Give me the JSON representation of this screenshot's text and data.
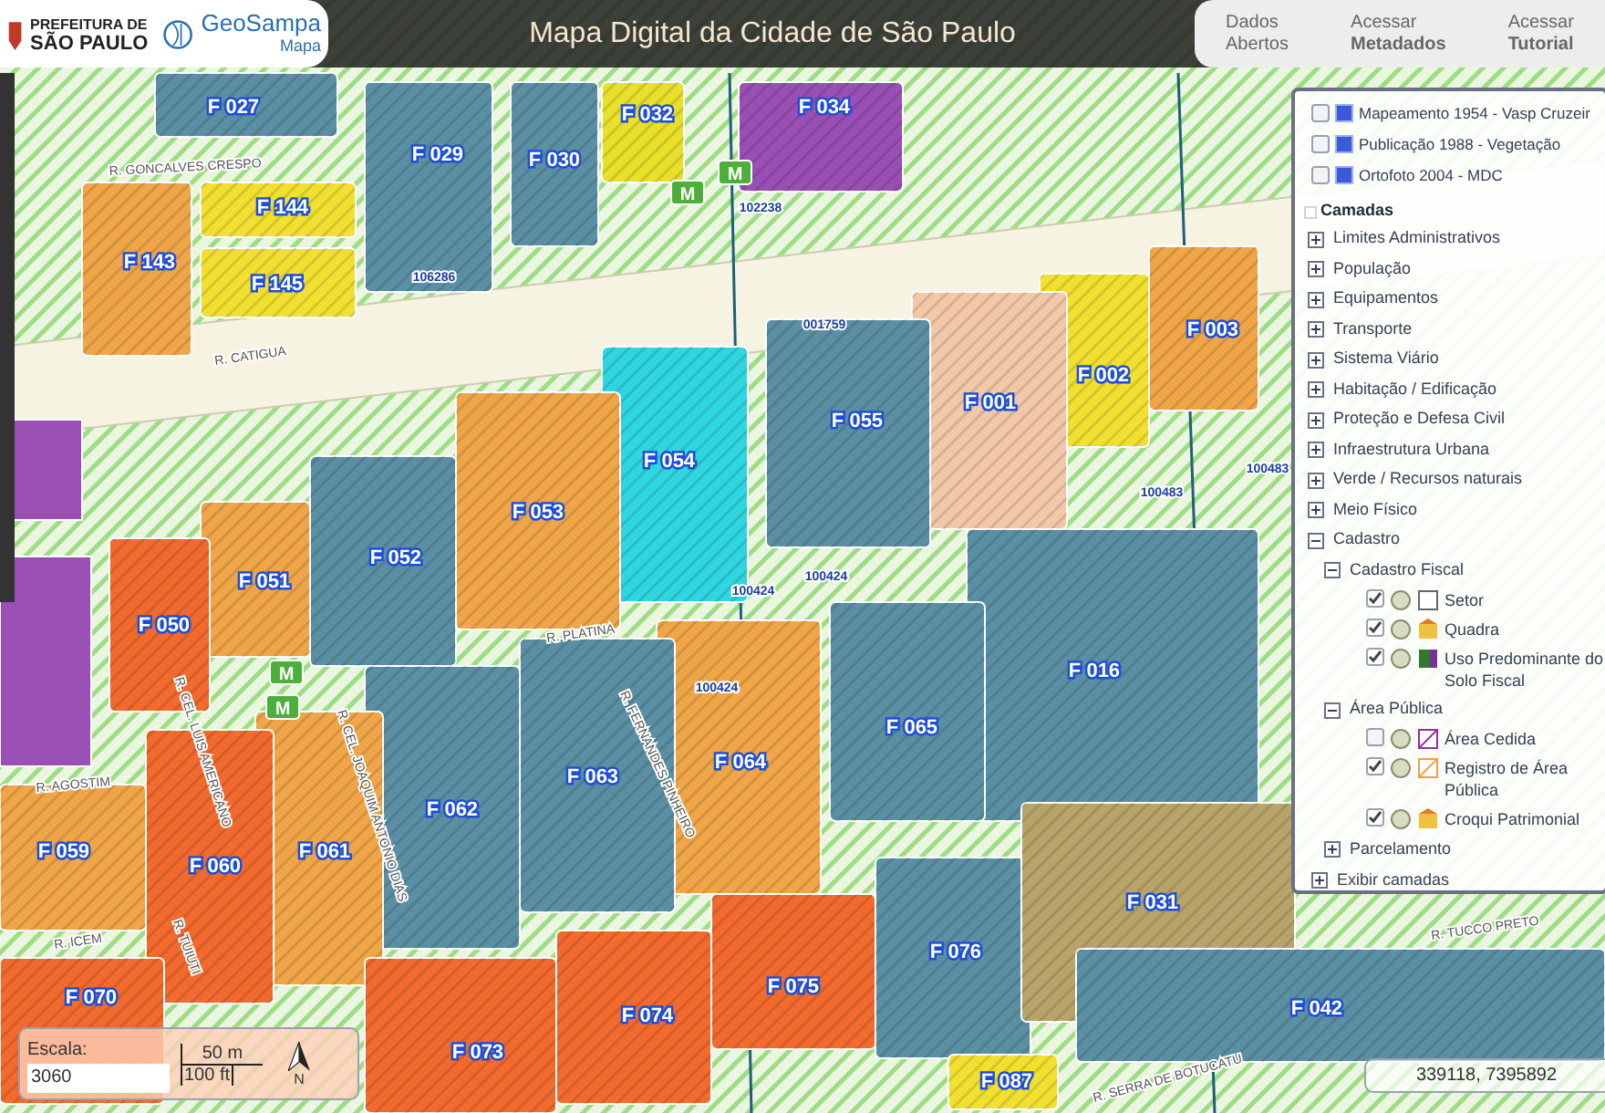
{
  "header": {
    "logo_top": "PREFEITURA DE",
    "logo_bottom": "SÃO PAULO",
    "brand": "GeoSampa",
    "brand_sub": "Mapa",
    "title": "Mapa Digital da Cidade de São Paulo",
    "links": [
      {
        "line1": "Dados",
        "line2": "Abertos",
        "bold": false
      },
      {
        "line1": "Acessar",
        "line2": "Metadados",
        "bold": true
      },
      {
        "line1": "Acessar",
        "line2": "Tutorial",
        "bold": true
      }
    ]
  },
  "map": {
    "lots": [
      {
        "label": "F 027",
        "color": "#5b8fa3"
      },
      {
        "label": "F 029",
        "color": "#5b8fa3"
      },
      {
        "label": "F 030",
        "color": "#5b8fa3"
      },
      {
        "label": "F 032",
        "color": "#e8e02a"
      },
      {
        "label": "F 034",
        "color": "#9a4fb5"
      },
      {
        "label": "F 144",
        "color": "#f1e030"
      },
      {
        "label": "F 145",
        "color": "#f1e030"
      },
      {
        "label": "F 143",
        "color": "#f0a648"
      },
      {
        "label": "F 003",
        "color": "#f0a648"
      },
      {
        "label": "F 002",
        "color": "#f1e030"
      },
      {
        "label": "F 001",
        "color": "#f2c8a8"
      },
      {
        "label": "F 055",
        "color": "#5b8fa3"
      },
      {
        "label": "F 054",
        "color": "#2fd6e0"
      },
      {
        "label": "F 053",
        "color": "#f0a648"
      },
      {
        "label": "F 052",
        "color": "#5b8fa3"
      },
      {
        "label": "F 051",
        "color": "#f0a648"
      },
      {
        "label": "F 050",
        "color": "#f26a2e"
      },
      {
        "label": "F 016",
        "color": "#5b8fa3"
      },
      {
        "label": "F 065",
        "color": "#5b8fa3"
      },
      {
        "label": "F 064",
        "color": "#f0a648"
      },
      {
        "label": "F 063",
        "color": "#5b8fa3"
      },
      {
        "label": "F 062",
        "color": "#5b8fa3"
      },
      {
        "label": "F 061",
        "color": "#f0a648"
      },
      {
        "label": "F 060",
        "color": "#f26a2e"
      },
      {
        "label": "F 059",
        "color": "#f0a648"
      },
      {
        "label": "F 070",
        "color": "#f26a2e"
      },
      {
        "label": "F 073",
        "color": "#f26a2e"
      },
      {
        "label": "F 074",
        "color": "#f26a2e"
      },
      {
        "label": "F 075",
        "color": "#f26a2e"
      },
      {
        "label": "F 076",
        "color": "#5b8fa3"
      },
      {
        "label": "F 031",
        "color": "#b8a46a"
      },
      {
        "label": "F 042",
        "color": "#5b8fa3"
      },
      {
        "label": "F 087",
        "color": "#f1e030"
      }
    ],
    "streets": [
      "R. GONCALVES CRESPO",
      "R. CATIGUA",
      "R. PLATINA",
      "R. CEL. LUIS AMERICANO",
      "R. CEL. JOAQUIM ANTONIO DIAS",
      "R. FERNANDES PINHEIRO",
      "R. TUIUTI",
      "R. ICEM",
      "R. SERRA DE BOTUCATU",
      "R. TUCCO PRETO",
      "R. AGOSTIM"
    ],
    "codes": [
      "102238",
      "106286",
      "001759",
      "100424",
      "100424",
      "100424",
      "100483",
      "100483"
    ],
    "stations": [
      "M",
      "M",
      "M",
      "M"
    ]
  },
  "layers": {
    "basemaps": [
      {
        "label": "Mapeamento 1954 - Vasp Cruzeir",
        "checked": false
      },
      {
        "label": "Publicação 1988 - Vegetação",
        "checked": false
      },
      {
        "label": "Ortofoto 2004 - MDC",
        "checked": false
      }
    ],
    "title": "Camadas",
    "tree": [
      {
        "label": "Limites Administrativos",
        "expanded": false
      },
      {
        "label": "População",
        "expanded": false
      },
      {
        "label": "Equipamentos",
        "expanded": false
      },
      {
        "label": "Transporte",
        "expanded": false
      },
      {
        "label": "Sistema Viário",
        "expanded": false
      },
      {
        "label": "Habitação / Edificação",
        "expanded": false
      },
      {
        "label": "Proteção e Defesa Civil",
        "expanded": false
      },
      {
        "label": "Infraestrutura Urbana",
        "expanded": false
      },
      {
        "label": "Verde / Recursos naturais",
        "expanded": false
      },
      {
        "label": "Meio Físico",
        "expanded": false
      },
      {
        "label": "Cadastro",
        "expanded": true,
        "children": [
          {
            "label": "Cadastro Fiscal",
            "expanded": true,
            "children": [
              {
                "kind": "outline",
                "label": "Setor",
                "checked": true
              },
              {
                "kind": "block",
                "label": "Quadra",
                "checked": true
              },
              {
                "kind": "landuse",
                "label": "Uso Predominante do Solo Fiscal",
                "checked": true
              }
            ]
          },
          {
            "label": "Área Pública",
            "expanded": true,
            "children": [
              {
                "kind": "purple-hatch",
                "label": "Área Cedida",
                "checked": false
              },
              {
                "kind": "orange-hatch",
                "label": "Registro de Área Pública",
                "checked": true
              },
              {
                "kind": "block",
                "label": "Croqui Patrimonial",
                "checked": true
              }
            ]
          },
          {
            "label": "Parcelamento",
            "expanded": false
          }
        ]
      }
    ],
    "footer": {
      "label": "Exibir camadas",
      "expanded": false
    }
  },
  "scale": {
    "label": "Escala:",
    "value": "3060",
    "metric": "50 m",
    "imperial": "100 ft",
    "north": "N"
  },
  "coordinates": "339118, 7395892"
}
